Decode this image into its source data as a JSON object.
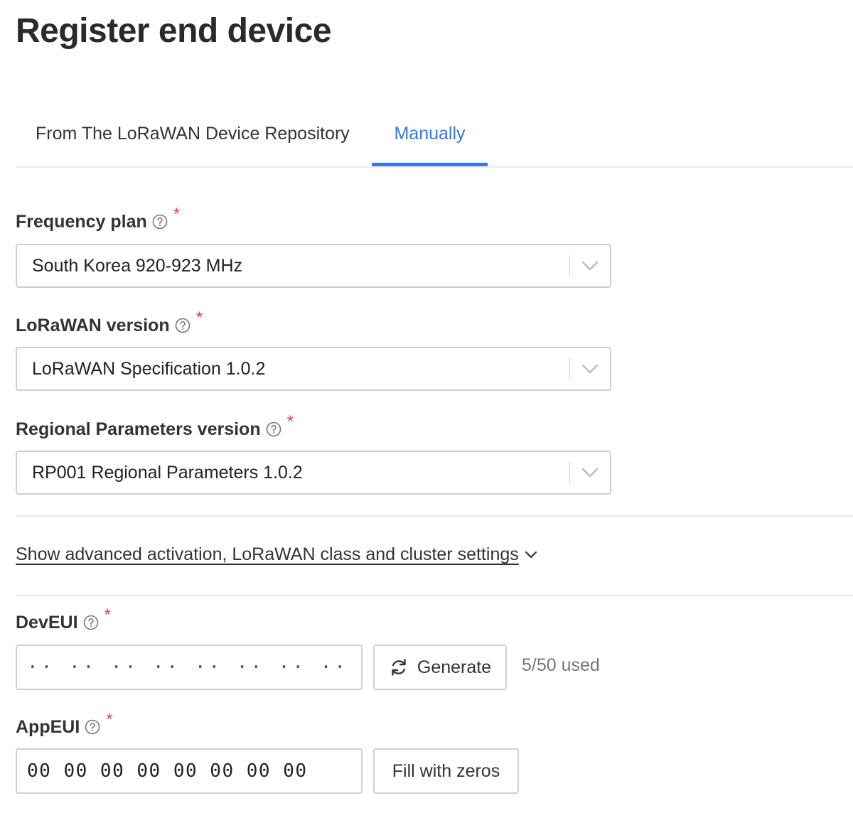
{
  "page": {
    "title": "Register end device"
  },
  "tabs": [
    {
      "label": "From The LoRaWAN Device Repository",
      "active": false
    },
    {
      "label": "Manually",
      "active": true
    }
  ],
  "fields": {
    "frequency_plan": {
      "label": "Frequency plan",
      "required_mark": "*",
      "value": "South Korea 920-923 MHz"
    },
    "lorawan_version": {
      "label": "LoRaWAN version",
      "required_mark": "*",
      "value": "LoRaWAN Specification 1.0.2"
    },
    "regional_parameters": {
      "label": "Regional Parameters version",
      "required_mark": "*",
      "value": "RP001 Regional Parameters 1.0.2"
    },
    "dev_eui": {
      "label": "DevEUI",
      "required_mark": "*",
      "value": "",
      "placeholder": "·· ·· ·· ·· ·· ·· ·· ··",
      "generate_label": "Generate",
      "usage": "5/50 used"
    },
    "app_eui": {
      "label": "AppEUI",
      "required_mark": "*",
      "value": "00 00 00 00 00 00 00 00",
      "fill_label": "Fill with zeros"
    }
  },
  "advanced": {
    "link_label": "Show advanced activation, LoRaWAN class and cluster settings"
  },
  "colors": {
    "accent": "#3478e6",
    "required": "#e64545",
    "border": "#cfcfcf",
    "divider": "#ebebeb"
  },
  "icons": [
    "help-circle-icon",
    "chevron-down-icon",
    "refresh-icon"
  ]
}
